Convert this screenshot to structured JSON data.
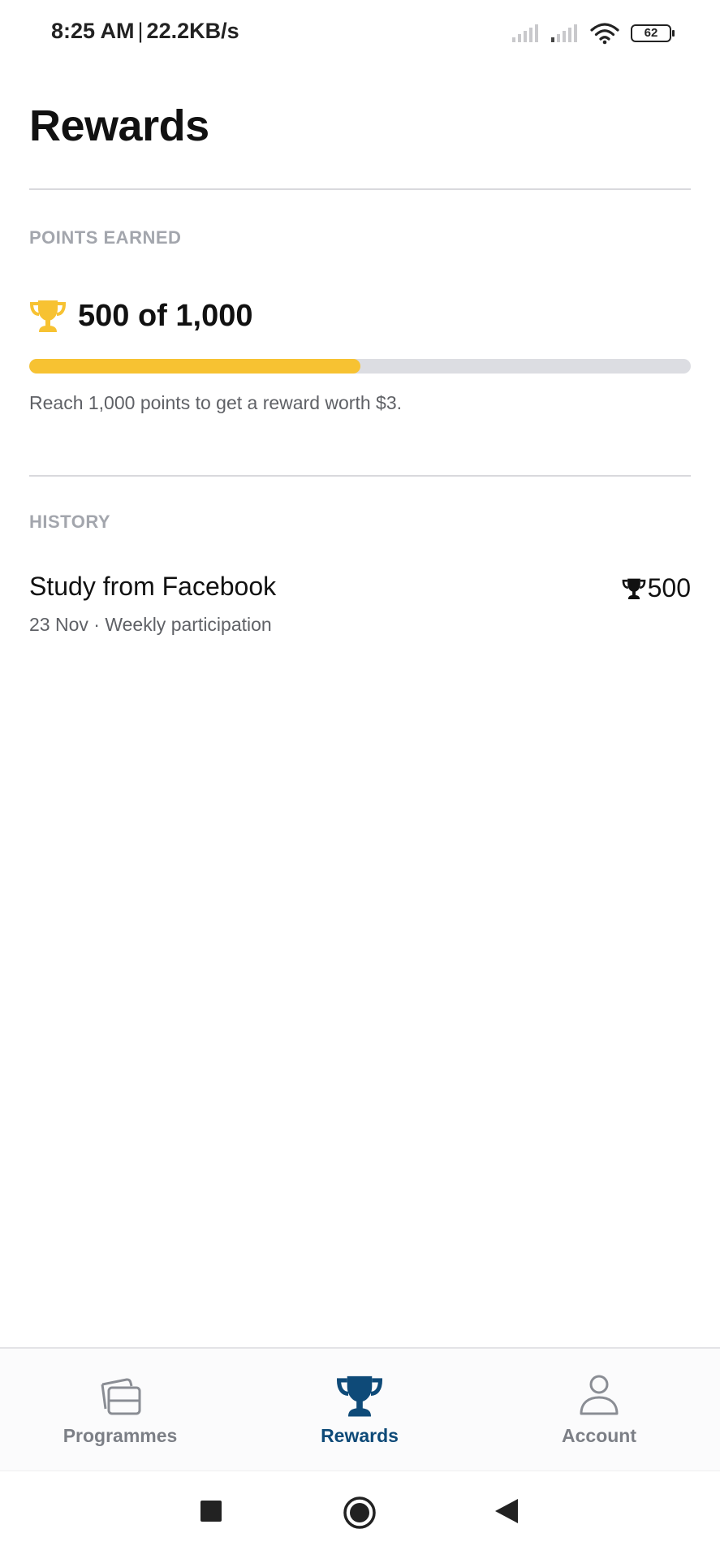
{
  "status_bar": {
    "time": "8:25 AM",
    "separator": "|",
    "network_speed": "22.2KB/s",
    "battery_level": "62",
    "icons": [
      "signal-icon",
      "signal-icon",
      "wifi-icon",
      "battery-icon"
    ]
  },
  "header": {
    "title": "Rewards"
  },
  "points_section": {
    "heading": "POINTS EARNED",
    "icon": "trophy-icon",
    "points_text": "500 of 1,000",
    "points_current": 500,
    "points_goal": 1000,
    "progress_fraction": 0.5,
    "caption": "Reach 1,000 points to get a reward worth $3."
  },
  "history_section": {
    "heading": "HISTORY",
    "items": [
      {
        "title": "Study from Facebook",
        "subtitle": "23 Nov · Weekly participation",
        "icon": "trophy-icon",
        "points": "500"
      }
    ]
  },
  "bottom_nav": {
    "items": [
      {
        "label": "Programmes",
        "icon": "programmes-icon",
        "active": false
      },
      {
        "label": "Rewards",
        "icon": "trophy-icon",
        "active": true
      },
      {
        "label": "Account",
        "icon": "person-icon",
        "active": false
      }
    ]
  },
  "system_nav": {
    "buttons": [
      "recents-button",
      "home-button",
      "back-button"
    ]
  },
  "colors": {
    "accent": "#f7c232",
    "nav_active": "#0e4a78",
    "nav_inactive": "#7c7f86",
    "muted_text": "#a3a6ad",
    "progress_track": "#dcdde2"
  }
}
